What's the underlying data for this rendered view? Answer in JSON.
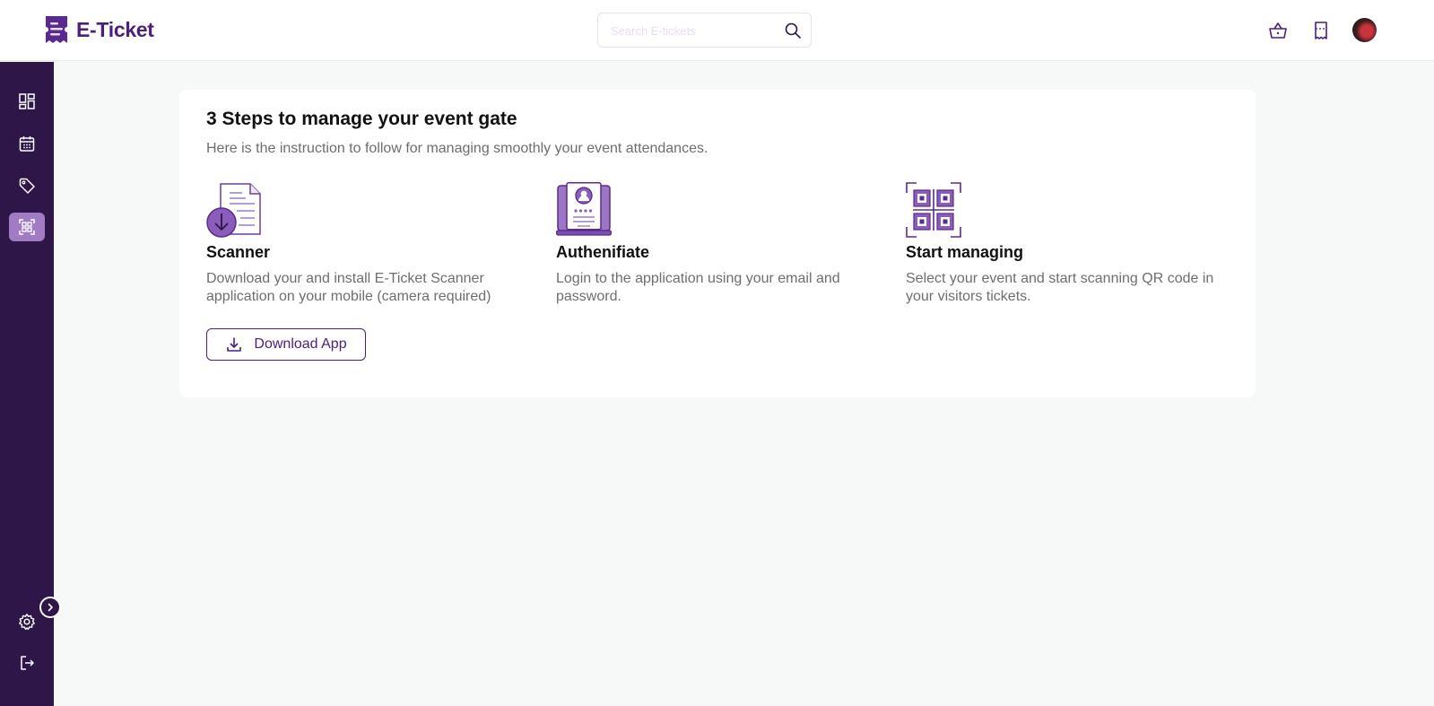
{
  "brand": {
    "name": "E-Ticket",
    "color": "#4b1f7a"
  },
  "header": {
    "search_placeholder": "Search E-tickets",
    "icons": [
      "basket-icon",
      "ticket-icon",
      "user-avatar"
    ]
  },
  "sidebar": {
    "items": [
      {
        "name": "dashboard",
        "icon": "dashboard-icon",
        "active": false
      },
      {
        "name": "calendar",
        "icon": "calendar-icon",
        "active": false
      },
      {
        "name": "tags",
        "icon": "tag-icon",
        "active": false
      },
      {
        "name": "scanner",
        "icon": "qr-scan-icon",
        "active": true
      }
    ],
    "bottom": [
      "settings-icon",
      "logout-icon"
    ],
    "colors": {
      "background": "#2e1648",
      "active": "#a17cc4"
    }
  },
  "card": {
    "title": "3 Steps to manage your event gate",
    "subtitle": "Here is the instruction to follow for managing smoothly your event attendances.",
    "steps": [
      {
        "title": "Scanner",
        "description": "Download your and install E-Ticket Scanner application on your mobile (camera required)",
        "icon": "document-download-icon"
      },
      {
        "title": "Authenifiate",
        "description": "Login to the application using your email and password.",
        "icon": "id-card-laptop-icon"
      },
      {
        "title": "Start managing",
        "description": "Select your event and start scanning QR code in your visitors tickets.",
        "icon": "qr-code-icon"
      }
    ],
    "download_button": "Download App"
  }
}
